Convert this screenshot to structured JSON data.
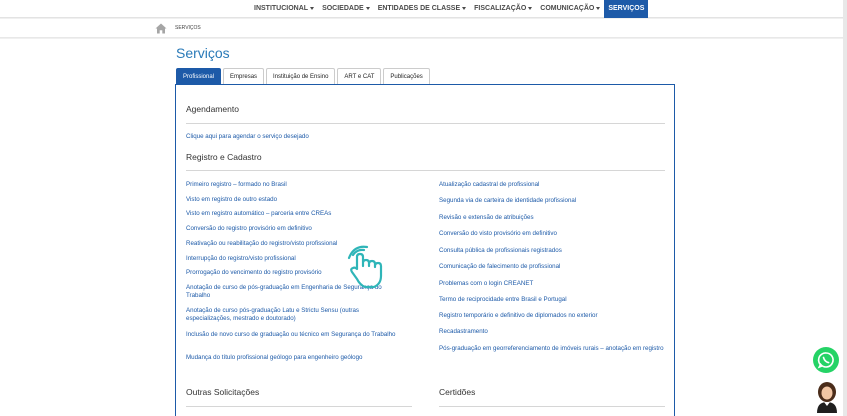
{
  "nav": {
    "items": [
      {
        "label": "INSTITUCIONAL",
        "dropdown": true
      },
      {
        "label": "SOCIEDADE",
        "dropdown": true
      },
      {
        "label": "ENTIDADES DE CLASSE",
        "dropdown": true
      },
      {
        "label": "FISCALIZAÇÃO",
        "dropdown": true
      },
      {
        "label": "COMUNICAÇÃO",
        "dropdown": true
      },
      {
        "label": "SERVIÇOS",
        "dropdown": false
      }
    ]
  },
  "breadcrumb": {
    "current": "SERVIÇOS"
  },
  "page": {
    "title": "Serviços"
  },
  "tabs": [
    "Profissional",
    "Empresas",
    "Instituição de Ensino",
    "ART e CAT",
    "Publicações"
  ],
  "agendamento": {
    "title": "Agendamento",
    "link": "Clique aqui para agendar o serviço desejado"
  },
  "registro": {
    "title": "Registro e Cadastro",
    "left": [
      "Primeiro registro – formado no Brasil",
      "Visto em registro de outro estado",
      "Visto em registro automático – parceria entre CREAs",
      "Conversão do registro provisório em definitivo",
      "Reativação ou reabilitação do registro/visto profissional",
      "Interrupção do registro/visto profissional",
      "Prorrogação do vencimento do registro provisório",
      "Anotação de curso de pós-graduação em Engenharia de Segurança do Trabalho",
      "Anotação de curso pós-graduação Latu e Strictu Sensu (outras especializações, mestrado e doutorado)",
      "Inclusão de novo curso de graduação ou técnico em Segurança do Trabalho",
      "Mudança do título profissional geólogo para engenheiro geólogo"
    ],
    "right": [
      "Atualização cadastral de profissional",
      "Segunda via de carteira de identidade profissional",
      "Revisão e extensão de atribuições",
      "Conversão do visto provisório em definitivo",
      "Consulta pública de profissionais registrados",
      "Comunicação de falecimento de profissional",
      "Problemas com o login CREANET",
      "Termo de reciprocidade entre Brasil e Portugal",
      "Registro temporário e definitivo de diplomados no exterior",
      "Recadastramento",
      "Pós-graduação em georreferenciamento de imóveis rurais – anotação em registro"
    ]
  },
  "outras": {
    "title": "Outras Solicitações"
  },
  "certidoes": {
    "title": "Certidões"
  },
  "colors": {
    "brand": "#1d5aa8",
    "title": "#2a7ab8",
    "whatsapp": "#25d366"
  }
}
